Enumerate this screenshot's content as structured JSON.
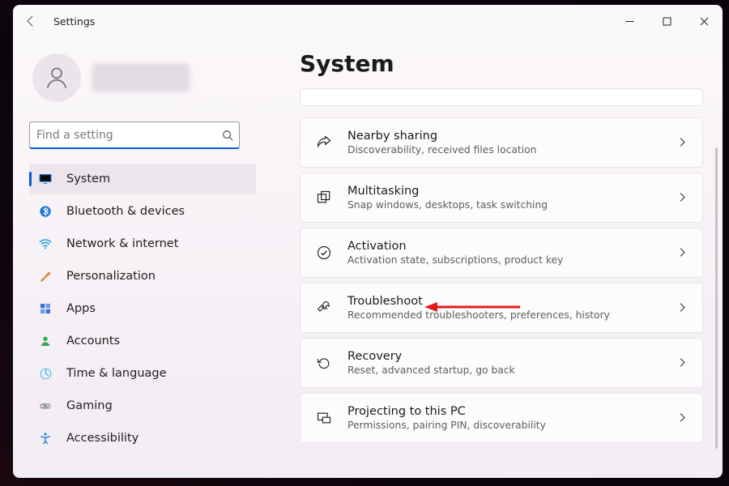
{
  "titlebar": {
    "app_title": "Settings"
  },
  "search": {
    "placeholder": "Find a setting"
  },
  "nav": {
    "items": [
      {
        "label": "System"
      },
      {
        "label": "Bluetooth & devices"
      },
      {
        "label": "Network & internet"
      },
      {
        "label": "Personalization"
      },
      {
        "label": "Apps"
      },
      {
        "label": "Accounts"
      },
      {
        "label": "Time & language"
      },
      {
        "label": "Gaming"
      },
      {
        "label": "Accessibility"
      }
    ],
    "selected_index": 0
  },
  "page": {
    "heading": "System"
  },
  "cards": [
    {
      "title": "Nearby sharing",
      "sub": "Discoverability, received files location"
    },
    {
      "title": "Multitasking",
      "sub": "Snap windows, desktops, task switching"
    },
    {
      "title": "Activation",
      "sub": "Activation state, subscriptions, product key"
    },
    {
      "title": "Troubleshoot",
      "sub": "Recommended troubleshooters, preferences, history"
    },
    {
      "title": "Recovery",
      "sub": "Reset, advanced startup, go back"
    },
    {
      "title": "Projecting to this PC",
      "sub": "Permissions, pairing PIN, discoverability"
    }
  ]
}
